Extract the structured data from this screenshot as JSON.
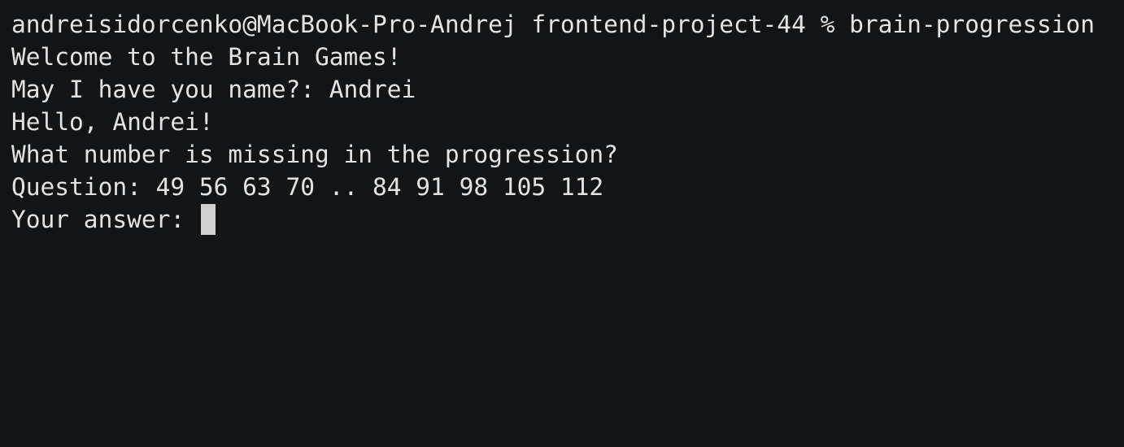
{
  "terminal": {
    "lines": [
      "andreisidorcenko@MacBook-Pro-Andrej frontend-project-44 % brain-progression",
      "Welcome to the Brain Games!",
      "May I have you name?: Andrei",
      "Hello, Andrei!",
      "What number is missing in the progression?",
      "Question: 49 56 63 70 .. 84 91 98 105 112"
    ],
    "input_prompt": "Your answer: ",
    "input_value": ""
  }
}
